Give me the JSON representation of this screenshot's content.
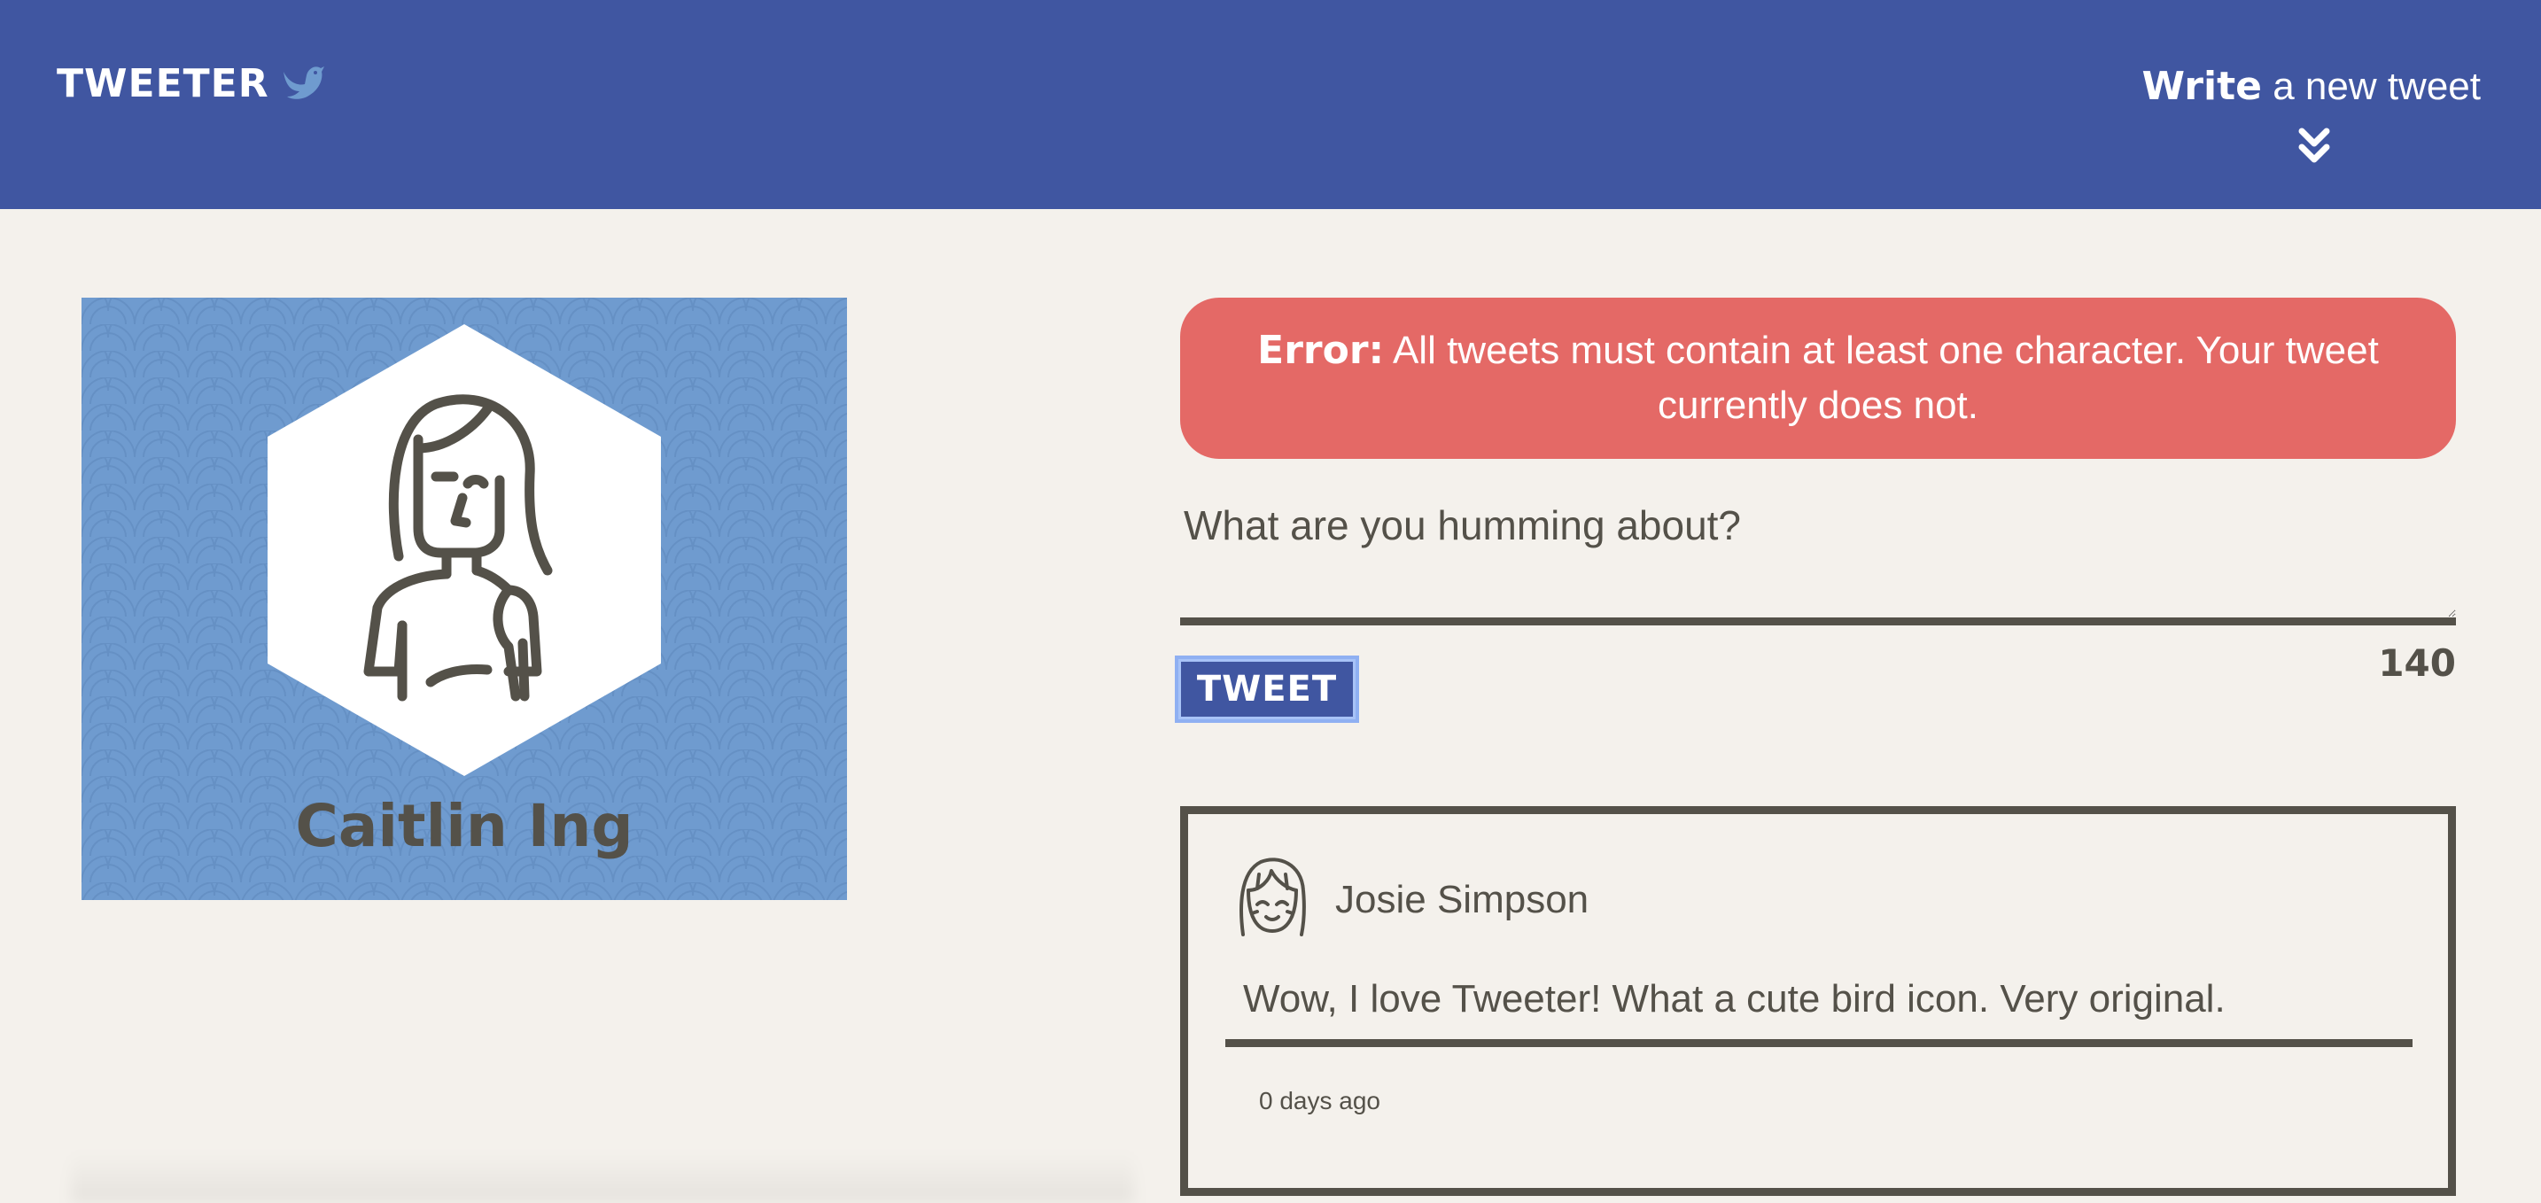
{
  "header": {
    "brand": "TWEETER",
    "brand_icon": "bird-icon",
    "compose_strong": "Write",
    "compose_rest": " a new tweet",
    "compose_icon": "double-chevron-down-icon",
    "background_color": "#4056a1"
  },
  "profile": {
    "name": "Caitlin Ing",
    "avatar_icon": "woman-avatar-icon",
    "card_color": "#6f9bcf"
  },
  "error": {
    "label": "Error:",
    "message": " All tweets must contain at least one character. Your tweet currently does not.",
    "color": "#e46966"
  },
  "compose": {
    "placeholder": "What are you humming about?",
    "value": "",
    "button_label": "TWEET",
    "counter": "140"
  },
  "tweets": [
    {
      "author": "Josie Simpson",
      "avatar_icon": "girl-avatar-icon",
      "text": "Wow, I love Tweeter! What a cute bird icon. Very original.",
      "timestamp": "0 days ago"
    }
  ]
}
